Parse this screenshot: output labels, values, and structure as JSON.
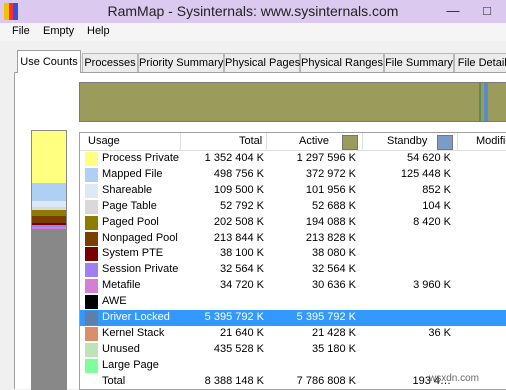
{
  "window": {
    "title": "RamMap - Sysinternals: www.sysinternals.com",
    "min_glyph": "—",
    "max_glyph": "□"
  },
  "menu": [
    "File",
    "Empty",
    "Help"
  ],
  "tabs": [
    "Use Counts",
    "Processes",
    "Priority Summary",
    "Physical Pages",
    "Physical Ranges",
    "File Summary",
    "File Details"
  ],
  "active_tab": "Use Counts",
  "columns": {
    "usage": "Usage",
    "total": "Total",
    "active": "Active",
    "standby": "Standby",
    "modified": "Modifie"
  },
  "colors": {
    "process_private": "#ffff80",
    "mapped_file": "#aed0f2",
    "shareable": "#dde9f7",
    "page_table": "#d9d9d9",
    "paged_pool": "#8c7d00",
    "nonpaged_pool": "#7a3e00",
    "system_pte": "#7a0000",
    "session_private": "#a07ff0",
    "metafile": "#d47fd4",
    "awe": "#000000",
    "driver_locked": "#5f7fa8",
    "kernel_stack": "#d98f6a",
    "unused": "#bfe3b9",
    "large_page": "#7dff9a",
    "total": "#ffffff",
    "active_swatch": "#9b9b5c",
    "standby_swatch": "#7b9cc6",
    "selection": "#3399ff"
  },
  "rows": [
    {
      "usage": "Process Private",
      "total": "1 352 404 K",
      "active": "1 297 596 K",
      "standby": "54 620 K",
      "color_key": "process_private"
    },
    {
      "usage": "Mapped File",
      "total": "498 756 K",
      "active": "372 972 K",
      "standby": "125 448 K",
      "color_key": "mapped_file"
    },
    {
      "usage": "Shareable",
      "total": "109 500 K",
      "active": "101 956 K",
      "standby": "852 K",
      "color_key": "shareable"
    },
    {
      "usage": "Page Table",
      "total": "52 792 K",
      "active": "52 688 K",
      "standby": "104 K",
      "color_key": "page_table"
    },
    {
      "usage": "Paged Pool",
      "total": "202 508 K",
      "active": "194 088 K",
      "standby": "8 420 K",
      "color_key": "paged_pool"
    },
    {
      "usage": "Nonpaged Pool",
      "total": "213 844 K",
      "active": "213 828 K",
      "standby": "",
      "color_key": "nonpaged_pool"
    },
    {
      "usage": "System PTE",
      "total": "38 100 K",
      "active": "38 080 K",
      "standby": "",
      "color_key": "system_pte"
    },
    {
      "usage": "Session Private",
      "total": "32 564 K",
      "active": "32 564 K",
      "standby": "",
      "color_key": "session_private"
    },
    {
      "usage": "Metafile",
      "total": "34 720 K",
      "active": "30 636 K",
      "standby": "3 960 K",
      "color_key": "metafile"
    },
    {
      "usage": "AWE",
      "total": "",
      "active": "",
      "standby": "",
      "color_key": "awe"
    },
    {
      "usage": "Driver Locked",
      "total": "5 395 792 K",
      "active": "5 395 792 K",
      "standby": "",
      "color_key": "driver_locked",
      "selected": true
    },
    {
      "usage": "Kernel Stack",
      "total": "21 640 K",
      "active": "21 428 K",
      "standby": "36 K",
      "color_key": "kernel_stack"
    },
    {
      "usage": "Unused",
      "total": "435 528 K",
      "active": "35 180 K",
      "standby": "",
      "color_key": "unused"
    },
    {
      "usage": "Large Page",
      "total": "",
      "active": "",
      "standby": "",
      "color_key": "large_page"
    },
    {
      "usage": "Total",
      "total": "8 388 148 K",
      "active": "7 786 808 K",
      "standby": "193 4…",
      "color_key": "total"
    }
  ],
  "watermark": "wsxdn.com"
}
